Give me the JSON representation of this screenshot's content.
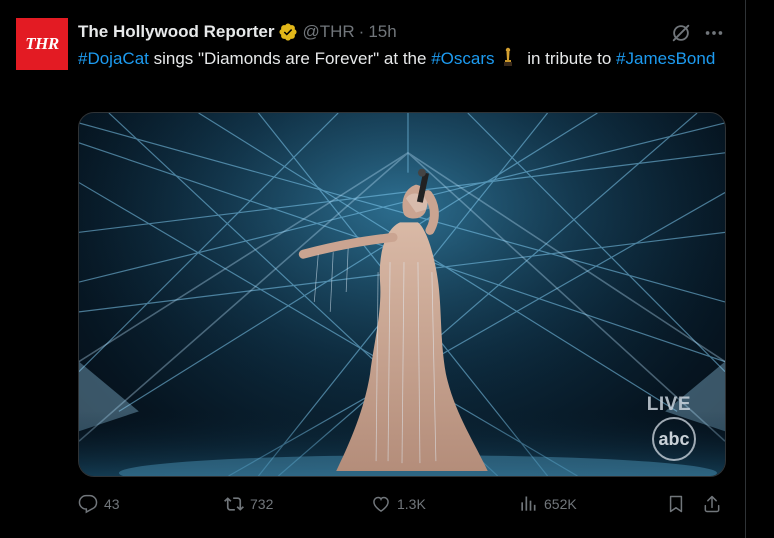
{
  "avatar": {
    "text": "THR"
  },
  "header": {
    "name": "The Hollywood Reporter",
    "handle": "@THR",
    "separator": "·",
    "time": "15h"
  },
  "tweet": {
    "hashtag1": "#DojaCat",
    "text1": " sings \"Diamonds are Forever\" at the ",
    "hashtag2": "#Oscars",
    "text2": " in tribute to ",
    "hashtag3": "#JamesBond"
  },
  "media": {
    "live_label": "LIVE",
    "network_logo": "abc"
  },
  "actions": {
    "replies": "43",
    "reposts": "732",
    "likes": "1.3K",
    "views": "652K"
  },
  "colors": {
    "accent": "#1d9bf0",
    "verified_gold": "#e2b719",
    "muted": "#71767b",
    "text": "#e7e9ea",
    "background": "#000000",
    "avatar_red": "#e31b23"
  },
  "icons": {
    "verified": "verified-badge-icon",
    "grok": "grok-icon",
    "more": "more-icon",
    "reply": "reply-icon",
    "repost": "repost-icon",
    "like": "like-icon",
    "views": "views-icon",
    "bookmark": "bookmark-icon",
    "share": "share-icon",
    "emoji": "oscar-statue-icon"
  }
}
